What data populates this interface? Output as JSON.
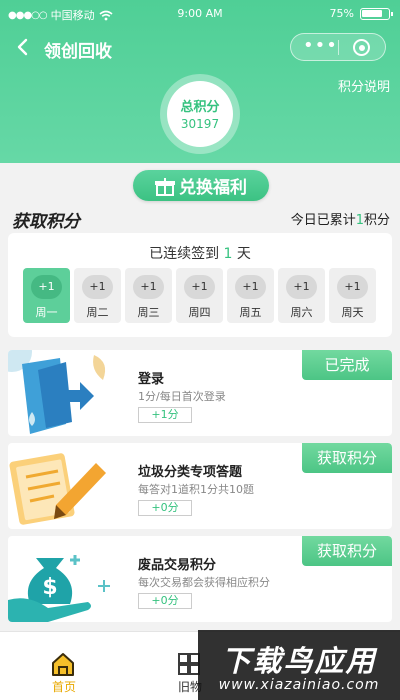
{
  "status_bar": {
    "carrier": "中国移动",
    "time": "9:00 AM",
    "battery": "75%"
  },
  "nav": {
    "back_icon": "chevron-left-icon",
    "title": "领创回收"
  },
  "header": {
    "rules_link": "积分说明",
    "score_label": "总积分",
    "score_value": "30197",
    "exchange_label": "兑换福利"
  },
  "earn": {
    "title": "获取积分",
    "today_prefix": "今日已累计",
    "today_value": "1",
    "today_suffix": "积分"
  },
  "signin": {
    "prefix": "已连续签到",
    "days": "1",
    "suffix": "天",
    "week": [
      {
        "points": "+1",
        "label": "周一",
        "active": true
      },
      {
        "points": "+1",
        "label": "周二",
        "active": false
      },
      {
        "points": "+1",
        "label": "周三",
        "active": false
      },
      {
        "points": "+1",
        "label": "周四",
        "active": false
      },
      {
        "points": "+1",
        "label": "周五",
        "active": false
      },
      {
        "points": "+1",
        "label": "周六",
        "active": false
      },
      {
        "points": "+1",
        "label": "周天",
        "active": false
      }
    ]
  },
  "tasks": [
    {
      "name": "登录",
      "desc": "1分/每日首次登录",
      "points": "+1分",
      "button": "已完成",
      "icon": "login-door-icon"
    },
    {
      "name": "垃圾分类专项答题",
      "desc": "每答对1道积1分共10题",
      "points": "+0分",
      "button": "获取积分",
      "icon": "quiz-pencil-icon"
    },
    {
      "name": "废品交易积分",
      "desc": "每次交易都会获得相应积分",
      "points": "+0分",
      "button": "获取积分",
      "icon": "money-bag-icon"
    }
  ],
  "bottom_nav": [
    {
      "label": "首页",
      "icon": "home-icon"
    },
    {
      "label": "旧物",
      "icon": "grid-icon"
    }
  ],
  "watermark": {
    "line1": "下载鸟应用",
    "line2": "www.xiazainiao.com"
  },
  "colors": {
    "primary": "#4fcf96",
    "accent_gold": "#e8a800"
  }
}
